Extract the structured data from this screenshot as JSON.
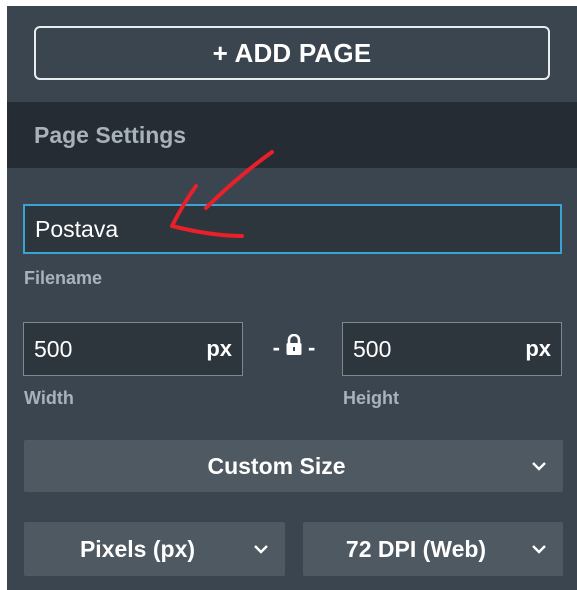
{
  "panel": {
    "add_page_label": "+ ADD PAGE",
    "section_title": "Page Settings"
  },
  "filename": {
    "value": "Postava",
    "label": "Filename"
  },
  "dimensions": {
    "width": {
      "value": "500",
      "unit": "px",
      "label": "Width"
    },
    "height": {
      "value": "500",
      "unit": "px",
      "label": "Height"
    },
    "separator_left": "-",
    "separator_right": "-",
    "lock_icon": "lock-icon"
  },
  "size_preset": {
    "selected": "Custom Size"
  },
  "units": {
    "selected": "Pixels (px)"
  },
  "dpi": {
    "selected": "72 DPI (Web)"
  },
  "colors": {
    "panel_bg": "#3a4550",
    "header_bg": "#252c33",
    "input_bg": "#2d353d",
    "focus_border": "#3aa3d4",
    "select_bg": "#4f5962",
    "annotation_arrow": "#e8202a"
  }
}
